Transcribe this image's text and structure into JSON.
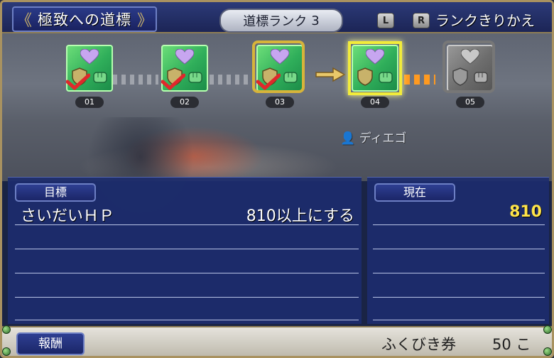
{
  "header": {
    "title": "極致への道標",
    "rank_label": "道標ランク",
    "rank_number": "3",
    "key_l": "L",
    "key_r": "R",
    "rank_switch_label": "ランクきりかえ"
  },
  "milestones": [
    {
      "label": "01",
      "status": "complete",
      "frame": "none"
    },
    {
      "label": "02",
      "status": "complete",
      "frame": "none"
    },
    {
      "label": "03",
      "status": "complete",
      "frame": "gold"
    },
    {
      "label": "04",
      "status": "current",
      "frame": "yellow"
    },
    {
      "label": "05",
      "status": "locked",
      "frame": "grey"
    }
  ],
  "icons": {
    "heart": "heart-icon",
    "shield": "shield-icon",
    "fist": "fist-icon",
    "check": "checkmark-icon",
    "arrow": "arrow-right-icon"
  },
  "npc_name": "ディエゴ",
  "goal_panel": {
    "label": "目標",
    "goal_text": "さいだいＨＰ",
    "goal_condition": "810以上にする"
  },
  "current_panel": {
    "label": "現在",
    "value": "810"
  },
  "reward": {
    "label": "報酬",
    "item": "ふくびき券",
    "quantity": "50 こ"
  },
  "colors": {
    "accent_gold": "#d7b43a",
    "current_yellow": "#f2ec3a",
    "value_yellow": "#ffe44a",
    "check_red": "#e0282c",
    "panel_blue": "#1c2c6e"
  }
}
